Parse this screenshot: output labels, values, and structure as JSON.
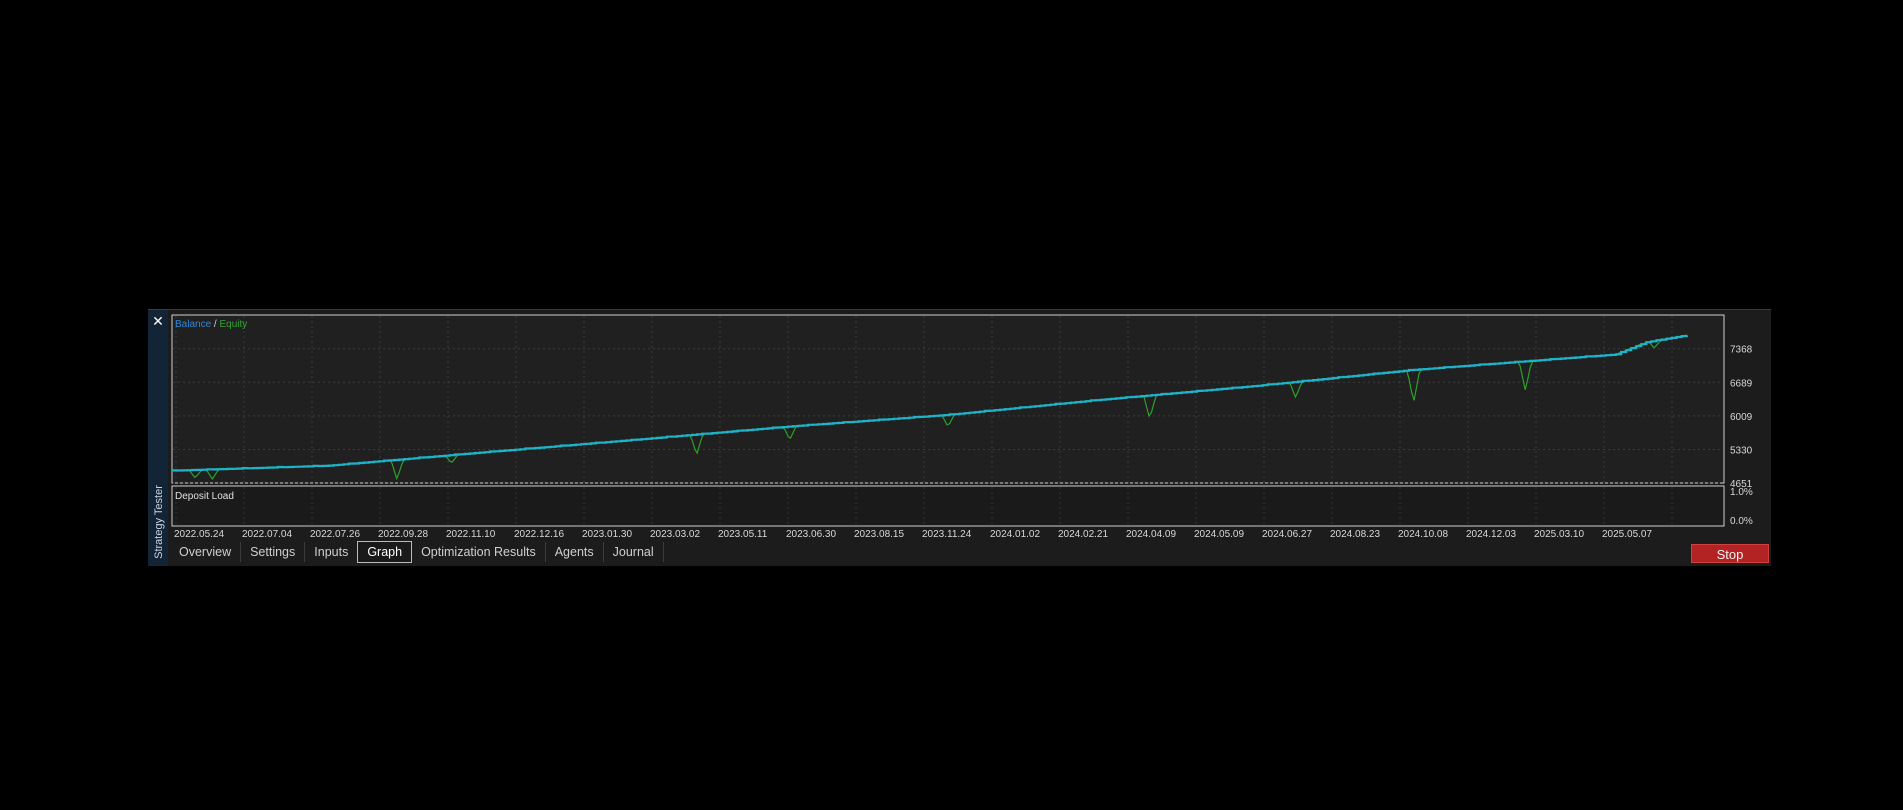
{
  "window": {
    "sidebar_title": "Strategy Tester",
    "close_icon": "close-icon"
  },
  "tabs": [
    {
      "label": "Overview",
      "active": false
    },
    {
      "label": "Settings",
      "active": false
    },
    {
      "label": "Inputs",
      "active": false
    },
    {
      "label": "Graph",
      "active": true
    },
    {
      "label": "Optimization Results",
      "active": false
    },
    {
      "label": "Agents",
      "active": false
    },
    {
      "label": "Journal",
      "active": false
    }
  ],
  "stop_label": "Stop",
  "chart_data": {
    "type": "line",
    "legend": [
      {
        "name": "Balance",
        "color": "#2f87d8"
      },
      {
        "name": "Equity",
        "color": "#2fa82f"
      }
    ],
    "legend_separator": "/",
    "ylim": [
      4651,
      8050
    ],
    "yticks": [
      "7368",
      "6689",
      "6009",
      "5330",
      "4651"
    ],
    "x_tick_labels": [
      "2022.05.24",
      "2022.07.04",
      "2022.07.26",
      "2022.09.28",
      "2022.11.10",
      "2022.12.16",
      "2023.01.30",
      "2023.03.02",
      "2023.05.11",
      "2023.06.30",
      "2023.08.15",
      "2023.11.24",
      "2024.01.02",
      "2024.02.21",
      "2024.04.09",
      "2024.05.09",
      "2024.06.27",
      "2024.08.23",
      "2024.10.08",
      "2024.12.03",
      "2025.03.10",
      "2025.05.07"
    ],
    "series": [
      {
        "name": "Balance",
        "color": "#1eb3c8",
        "x": [
          0,
          0.1,
          0.2,
          0.3,
          0.4,
          0.5,
          0.6,
          0.7,
          0.8,
          0.9,
          0.93,
          0.95,
          0.976
        ],
        "values": [
          4900,
          5000,
          5270,
          5530,
          5800,
          6030,
          6340,
          6620,
          6940,
          7180,
          7250,
          7500,
          7640
        ]
      },
      {
        "name": "Equity",
        "color": "#2aa12a",
        "dips": [
          {
            "x": 0.015,
            "y": 4750
          },
          {
            "x": 0.026,
            "y": 4730
          },
          {
            "x": 0.145,
            "y": 4720
          },
          {
            "x": 0.18,
            "y": 5050
          },
          {
            "x": 0.338,
            "y": 5220
          },
          {
            "x": 0.398,
            "y": 5520
          },
          {
            "x": 0.5,
            "y": 5790
          },
          {
            "x": 0.63,
            "y": 5950
          },
          {
            "x": 0.724,
            "y": 6380
          },
          {
            "x": 0.872,
            "y": 6520
          },
          {
            "x": 0.8,
            "y": 6270
          },
          {
            "x": 0.955,
            "y": 7380
          }
        ]
      }
    ],
    "sub_panel": {
      "label": "Deposit Load",
      "yticks": [
        "1.0%",
        "0.0%"
      ]
    }
  }
}
